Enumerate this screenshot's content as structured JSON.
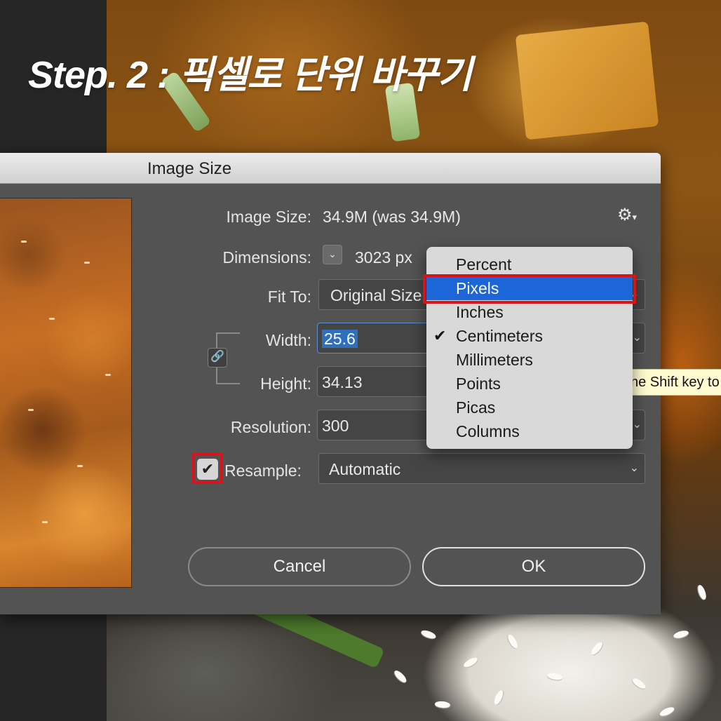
{
  "overlay_title": "Step. 2 : 픽셀로 단위 바꾸기",
  "dialog": {
    "title": "Image Size",
    "image_size_label": "Image Size:",
    "image_size_value": "34.9M (was 34.9M)",
    "gear_icon": "gear-icon",
    "dimensions_label": "Dimensions:",
    "dimensions_value": "3023 px",
    "fit_to_label": "Fit To:",
    "fit_to_value": "Original Size",
    "width_label": "Width:",
    "width_value": "25.6",
    "height_label": "Height:",
    "height_value": "34.13",
    "resolution_label": "Resolution:",
    "resolution_value": "300",
    "resample_label": "Resample:",
    "resample_checked": true,
    "resample_value": "Automatic",
    "cancel_label": "Cancel",
    "ok_label": "OK"
  },
  "unit_menu": {
    "items": [
      "Percent",
      "Pixels",
      "Inches",
      "Centimeters",
      "Millimeters",
      "Points",
      "Picas",
      "Columns"
    ],
    "highlighted": "Pixels",
    "checked": "Centimeters"
  },
  "tooltip": "ne Shift key to",
  "colors": {
    "highlight_box": "#d6141b",
    "menu_highlight": "#1c66d9",
    "dialog_bg": "#535353"
  }
}
